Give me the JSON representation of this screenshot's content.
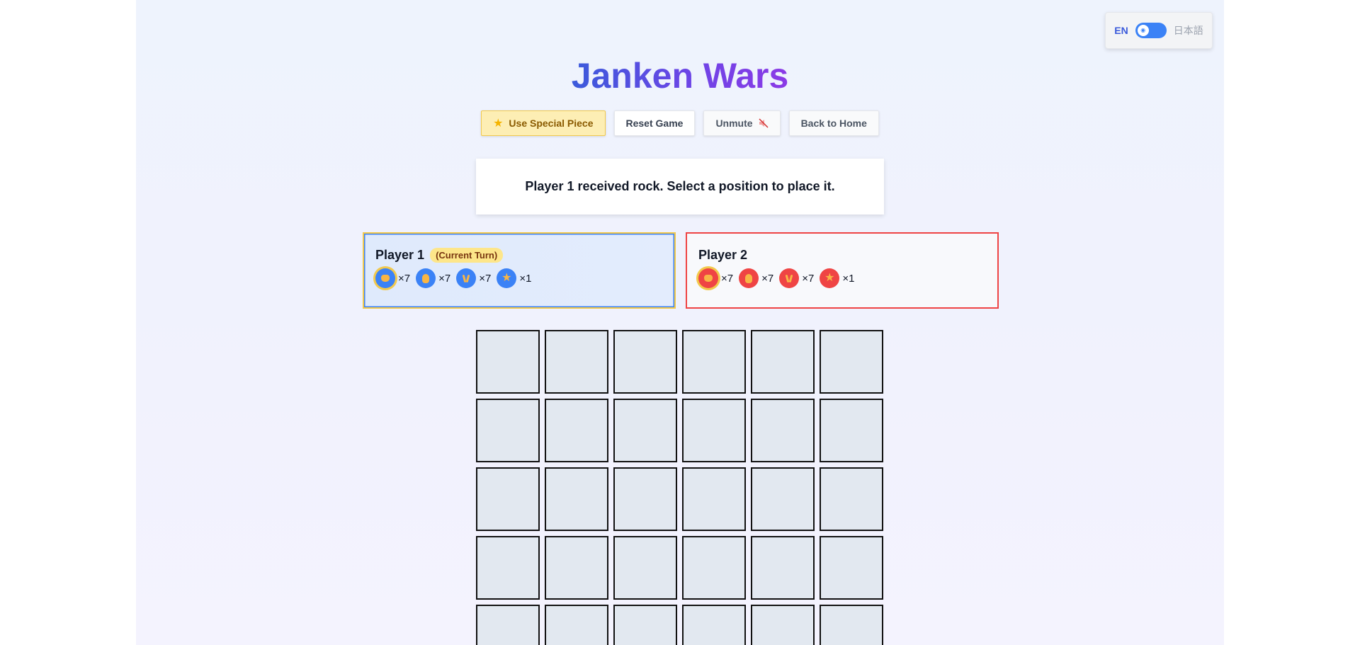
{
  "language_toggle": {
    "en_label": "EN",
    "ja_label": "日本語",
    "selected": "EN"
  },
  "title": "Janken Wars",
  "toolbar": {
    "special_label": "Use Special Piece",
    "reset_label": "Reset Game",
    "mute_label": "Unmute",
    "home_label": "Back to Home"
  },
  "status_message": "Player 1 received rock. Select a position to place it.",
  "players": [
    {
      "name": "Player 1",
      "turn_badge": "(Current Turn)",
      "color": "#3b82f6",
      "pieces": [
        {
          "icon": "rock-icon",
          "count": "×7",
          "selected": true
        },
        {
          "icon": "paper-icon",
          "count": "×7"
        },
        {
          "icon": "scissors-icon",
          "count": "×7"
        },
        {
          "icon": "star-icon",
          "count": "×1"
        }
      ]
    },
    {
      "name": "Player 2",
      "color": "#ef4444",
      "pieces": [
        {
          "icon": "rock-icon",
          "count": "×7",
          "selected": true
        },
        {
          "icon": "paper-icon",
          "count": "×7"
        },
        {
          "icon": "scissors-icon",
          "count": "×7"
        },
        {
          "icon": "star-icon",
          "count": "×1"
        }
      ]
    }
  ],
  "board": {
    "columns": 6,
    "visible_rows": 5
  },
  "colors": {
    "accent_gradient": [
      "#3b5bdb",
      "#8b3ae6"
    ],
    "highlight": "#f2c94c"
  }
}
